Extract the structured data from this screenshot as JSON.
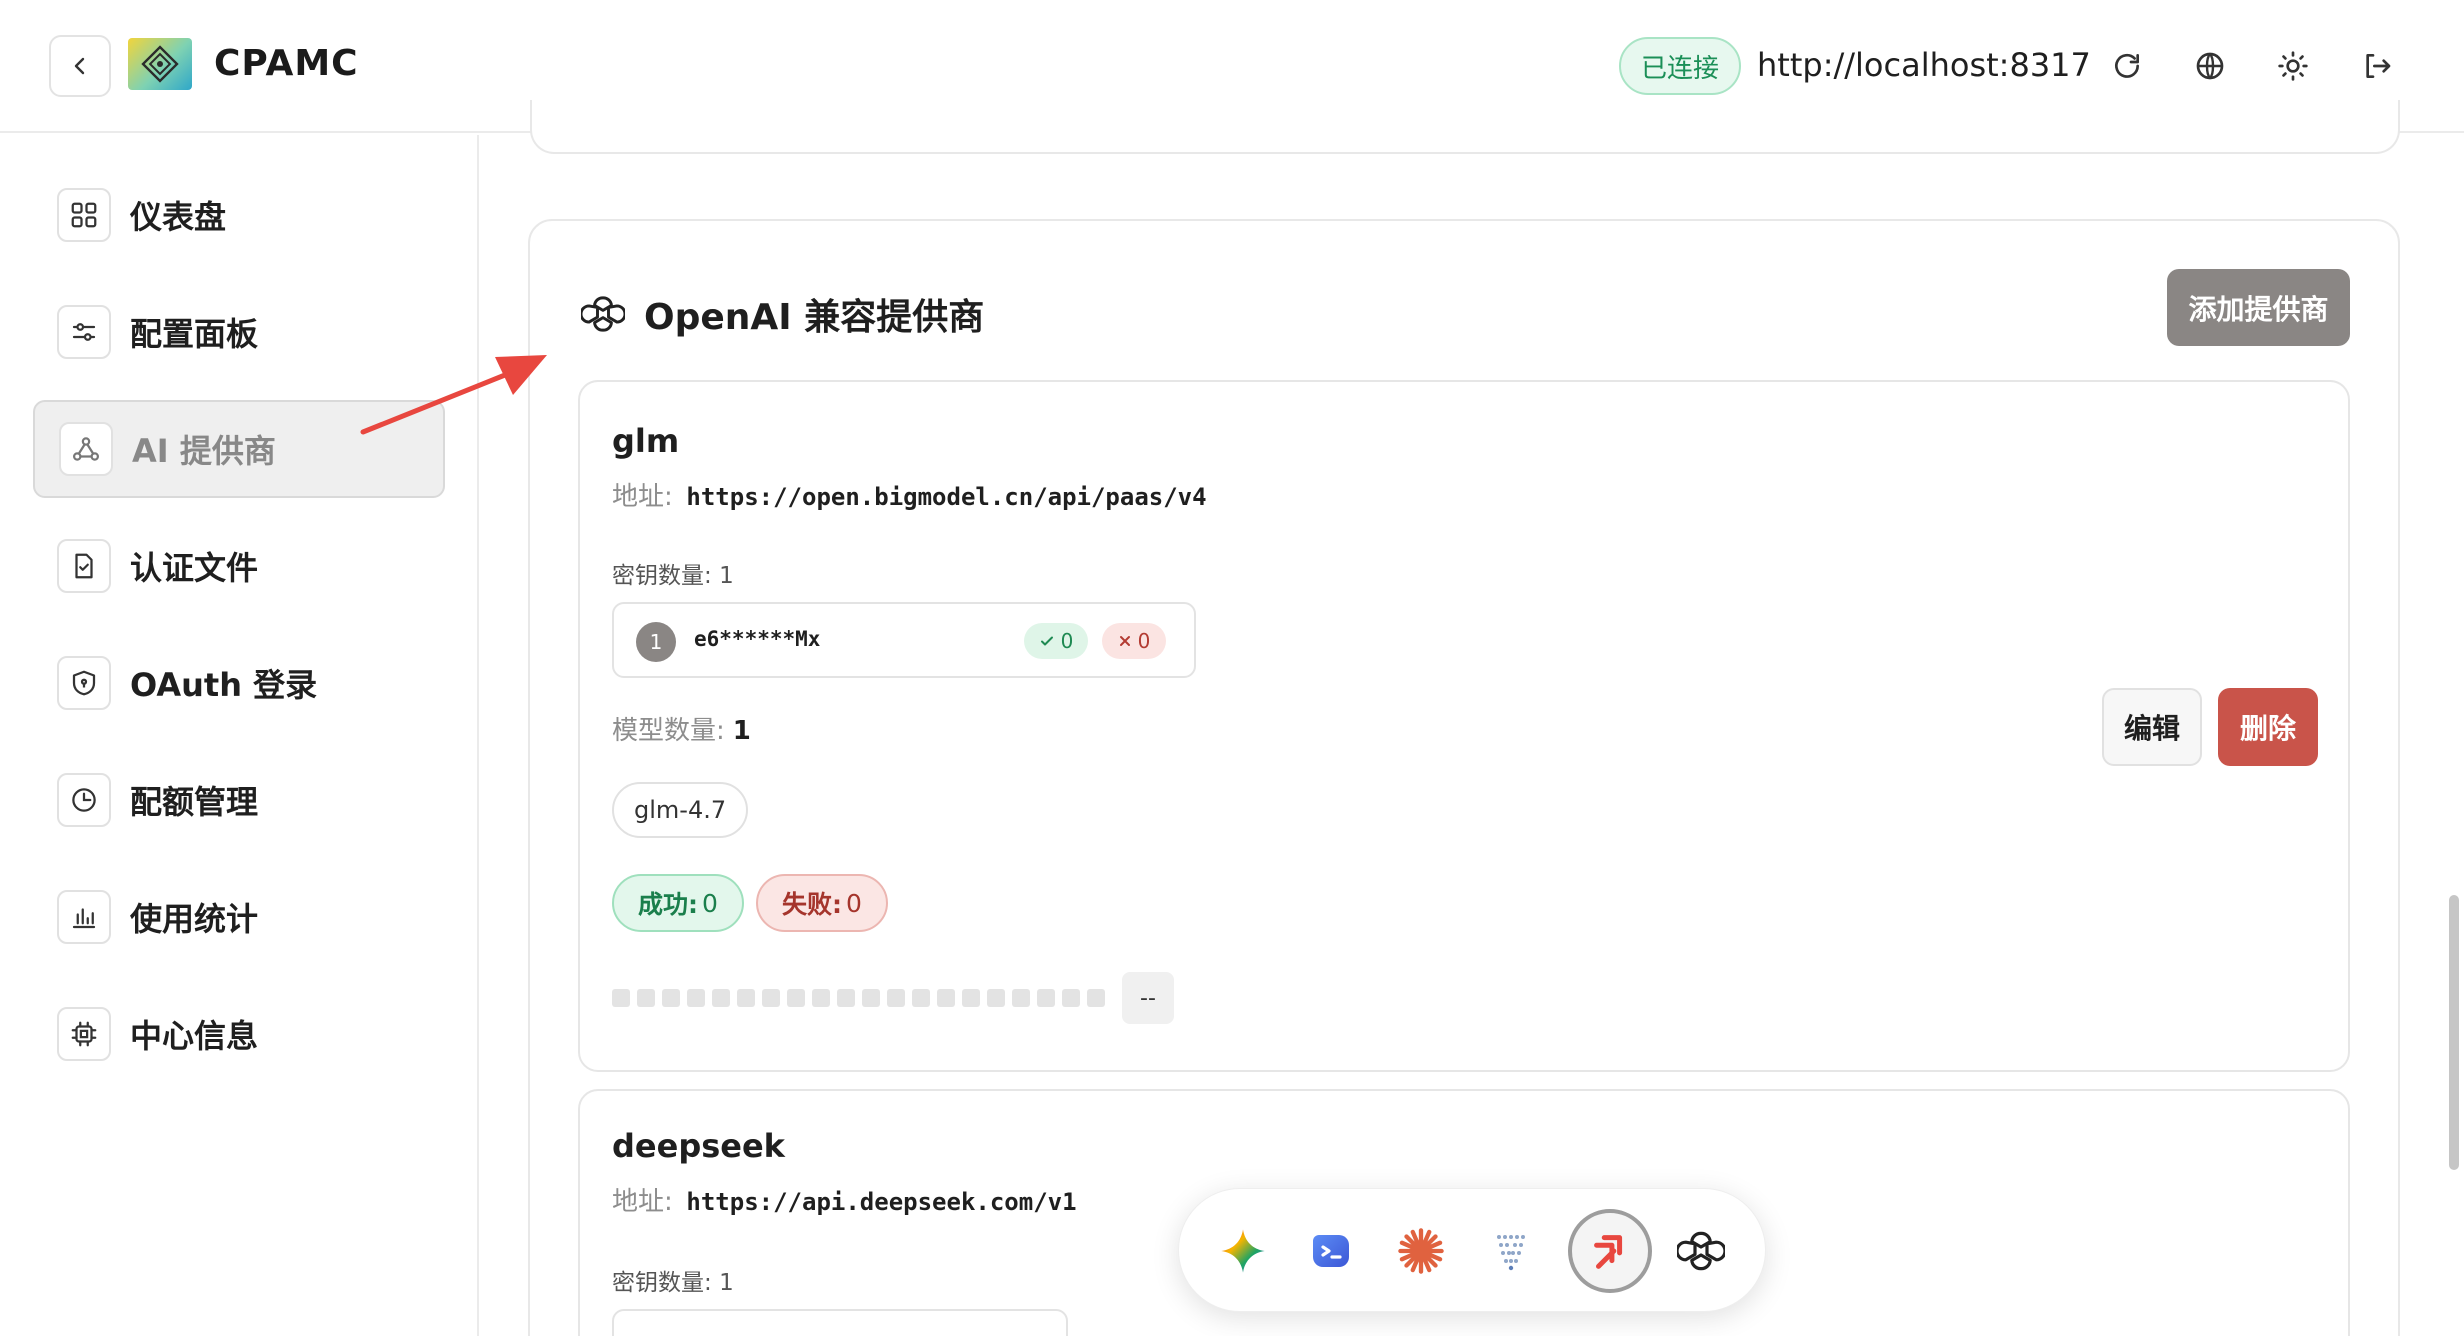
{
  "header": {
    "app_title": "CPAMC",
    "connection_status": "已连接",
    "server_url": "http://localhost:8317",
    "icons": [
      "back-icon",
      "refresh-icon",
      "globe-icon",
      "sun-icon",
      "logout-icon"
    ]
  },
  "sidebar": {
    "items": [
      {
        "label": "仪表盘",
        "icon": "dashboard-icon"
      },
      {
        "label": "配置面板",
        "icon": "sliders-icon"
      },
      {
        "label": "AI 提供商",
        "icon": "network-icon",
        "active": true
      },
      {
        "label": "认证文件",
        "icon": "file-check-icon"
      },
      {
        "label": "OAuth 登录",
        "icon": "shield-icon"
      },
      {
        "label": "配额管理",
        "icon": "pie-chart-icon"
      },
      {
        "label": "使用统计",
        "icon": "bar-chart-icon"
      },
      {
        "label": "中心信息",
        "icon": "cpu-icon"
      }
    ]
  },
  "section": {
    "title": "OpenAI 兼容提供商",
    "add_button": "添加提供商"
  },
  "providers": [
    {
      "name": "glm",
      "address_label": "地址:",
      "address": "https://open.bigmodel.cn/api/paas/v4",
      "key_count_label": "密钥数量:",
      "key_count": "1",
      "keys": [
        {
          "index": "1",
          "masked": "e6******Mx",
          "ok": "0",
          "fail": "0"
        }
      ],
      "model_count_label": "模型数量:",
      "model_count": "1",
      "models": [
        "glm-4.7"
      ],
      "success_label": "成功:",
      "success": "0",
      "failure_label": "失败:",
      "failure": "0",
      "health_label": "--",
      "edit_button": "编辑",
      "delete_button": "删除"
    },
    {
      "name": "deepseek",
      "address_label": "地址:",
      "address": "https://api.deepseek.com/v1",
      "key_count_label": "密钥数量:",
      "key_count": "1"
    }
  ],
  "dock": {
    "items": [
      "gemini-icon",
      "terminal-icon",
      "claude-icon",
      "vertex-icon",
      "ampcode-icon",
      "openai-icon"
    ],
    "active": "ampcode-icon"
  },
  "colors": {
    "accent_gray": "#8a8684",
    "success_green": "#1b7f4c",
    "danger_red": "#c9544a",
    "annotation_arrow": "#e8473f"
  }
}
